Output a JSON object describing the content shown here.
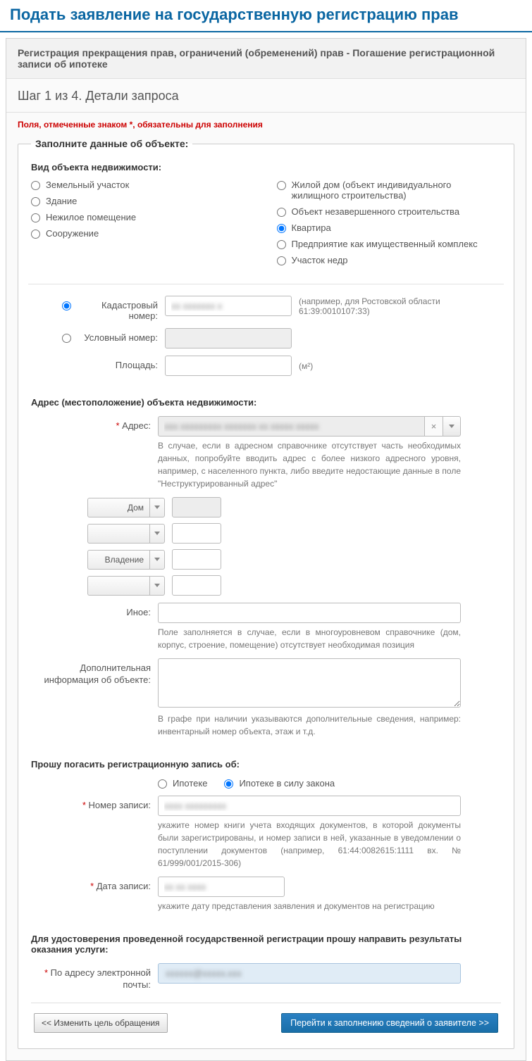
{
  "page_title": "Подать заявление на государственную регистрацию прав",
  "section_header": "Регистрация прекращения прав, ограничений (обременений) прав - Погашение регистрационной записи об ипотеке",
  "step_title": "Шаг 1 из 4. Детали запроса",
  "required_note": "Поля, отмеченные знаком *, обязательны для заполнения",
  "legend_object": "Заполните данные об объекте:",
  "property_type_label": "Вид объекта недвижимости:",
  "property_types_left": [
    "Земельный участок",
    "Здание",
    "Нежилое помещение",
    "Сооружение"
  ],
  "property_types_right": [
    "Жилой дом (объект индивидуального жилищного строительства)",
    "Объект незавершенного строительства",
    "Квартира",
    "Предприятие как имущественный комплекс",
    "Участок недр"
  ],
  "cadastral_label": "Кадастровый номер:",
  "cadastral_hint": "(например, для Ростовской области 61:39:0010107:33)",
  "conditional_label": "Условный номер:",
  "area_label": "Площадь:",
  "area_unit": "(м²)",
  "address_section": "Адрес (местоположение) объекта недвижимости:",
  "address_label": "Адрес:",
  "address_hint": "В случае, если в адресном справочнике отсутствует часть необходимых данных, попробуйте вводить адрес с более низкого адресного уровня, например, с населенного пункта, либо введите недостающие данные в поле \"Неструктурированный адрес\"",
  "house_label": "Дом",
  "possession_label": "Владение",
  "other_label": "Иное:",
  "other_hint": "Поле заполняется в случае, если в многоуровневом справочнике (дом, корпус, строение, помещение) отсутствует необходимая позиция",
  "additional_info_label": "Дополнительная информация об объекте:",
  "additional_info_hint": "В графе при наличии указываются дополнительные сведения, например: инвентарный номер объекта, этаж и т.д.",
  "cancel_section": "Прошу погасить регистрационную запись об:",
  "mortgage_option1": "Ипотеке",
  "mortgage_option2": "Ипотеке в силу закона",
  "record_number_label": "Номер записи:",
  "record_number_hint": "укажите номер книги учета входящих документов, в которой документы были зарегистрированы, и номер записи в ней, указанные в уведомлении о поступлении документов (например, 61:44:0082615:1111 вх. № 61/999/001/2015-306)",
  "record_date_label": "Дата записи:",
  "record_date_hint": "укажите дату представления заявления и документов на регистрацию",
  "delivery_section": "Для удостоверения проведенной государственной регистрации прошу направить результаты оказания услуги:",
  "email_label": "По адресу электронной почты:",
  "btn_back": "<< Изменить цель обращения",
  "btn_next": "Перейти к заполнению сведений о заявителе >>",
  "masked_cadastral": "xx xxxxxxx x",
  "masked_address": "xxx xxxxxxxxx xxxxxxx xx xxxxx xxxxx",
  "masked_record": "xxxx xxxxxxxxx",
  "masked_date": "xx xx xxxx",
  "masked_email": "xxxxxx@xxxxx.xxx"
}
